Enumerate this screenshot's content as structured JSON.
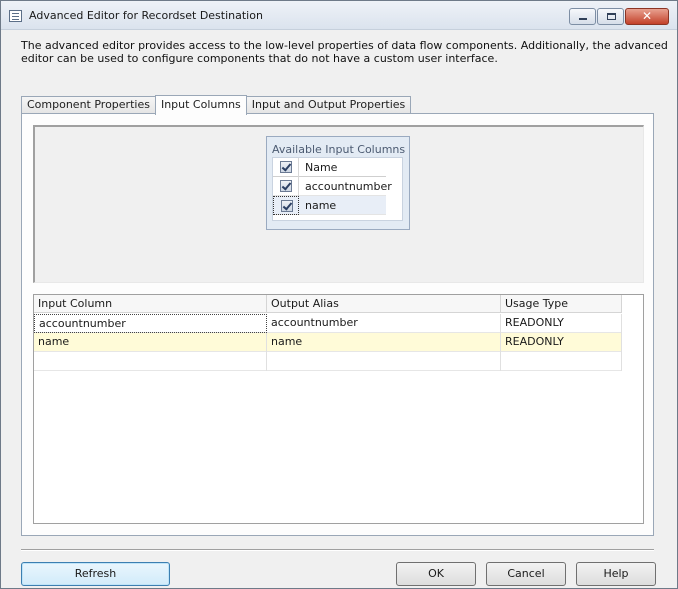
{
  "window": {
    "title": "Advanced Editor for Recordset Destination",
    "close_glyph": "✕"
  },
  "description": "The advanced editor provides access to the low-level properties of data flow components. Additionally, the advanced editor can be used to configure components that do not have a custom user interface.",
  "tabs": [
    {
      "label": "Component Properties",
      "active": false
    },
    {
      "label": "Input Columns",
      "active": true
    },
    {
      "label": "Input and Output Properties",
      "active": false
    }
  ],
  "available_columns": {
    "title": "Available Input Columns",
    "header": {
      "label": "Name",
      "checked": true
    },
    "items": [
      {
        "label": "accountnumber",
        "checked": true
      },
      {
        "label": "name",
        "checked": true
      }
    ]
  },
  "grid": {
    "columns": [
      "Input Column",
      "Output Alias",
      "Usage Type"
    ],
    "rows": [
      [
        "accountnumber",
        "accountnumber",
        "READONLY"
      ],
      [
        "name",
        "name",
        "READONLY"
      ]
    ]
  },
  "buttons": {
    "refresh": "Refresh",
    "ok": "OK",
    "cancel": "Cancel",
    "help": "Help"
  },
  "colors": {
    "highlight_row": "#fffbd8",
    "default_button_border": "#3c7fb1"
  }
}
